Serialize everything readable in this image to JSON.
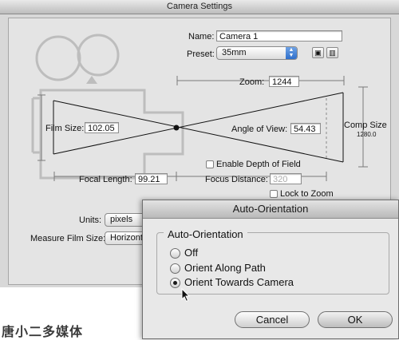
{
  "camera_settings": {
    "window_title": "Camera Settings",
    "name_label": "Name:",
    "name_value": "Camera 1",
    "preset_label": "Preset:",
    "preset_value": "35mm",
    "zoom_label": "Zoom:",
    "zoom_value": "1244",
    "film_size_label": "Film Size:",
    "film_size_value": "102.05",
    "angle_label": "Angle of View:",
    "angle_value": "54.43",
    "comp_size_label": "Comp Size",
    "comp_size_value": "1280.0",
    "enable_dof_label": "Enable Depth of Field",
    "focal_length_label": "Focal Length:",
    "focal_length_value": "99.21",
    "focus_distance_label": "Focus Distance:",
    "focus_distance_value": "320",
    "lock_zoom_label": "Lock to Zoom",
    "units_label": "Units:",
    "units_value": "pixels",
    "measure_label": "Measure Film Size:",
    "measure_value": "Horizonta"
  },
  "auto_orientation": {
    "title": "Auto-Orientation",
    "group_label": "Auto-Orientation",
    "options": [
      {
        "label": "Off",
        "selected": false
      },
      {
        "label": "Orient Along Path",
        "selected": false
      },
      {
        "label": "Orient Towards Camera",
        "selected": true
      }
    ],
    "cancel_label": "Cancel",
    "ok_label": "OK"
  },
  "watermark": "唐小二多媒体",
  "icons": [
    "save-preset-icon",
    "delete-preset-icon",
    "popup-arrows-icon",
    "camera-silhouette-icon",
    "mouse-pointer-icon"
  ]
}
